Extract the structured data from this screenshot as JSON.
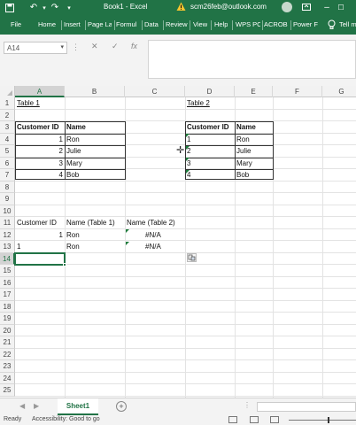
{
  "titlebar": {
    "title": "Book1 - Excel",
    "account": "scm26feb@outlook.com",
    "colors": {
      "brand": "#217346"
    }
  },
  "ribbon_tabs": [
    "File",
    "Home",
    "Insert",
    "Page La",
    "Formul",
    "Data",
    "Review",
    "View",
    "Help",
    "WPS PC",
    "ACROB",
    "Power F"
  ],
  "tell_me": "Tell m",
  "formula_bar": {
    "name_box": "A14",
    "icons": [
      "cancel-icon",
      "enter-icon",
      "fx-icon"
    ],
    "cancel_glyph": "✕",
    "enter_glyph": "✓",
    "fx_glyph": "fx",
    "content": ""
  },
  "columns": [
    "A",
    "B",
    "C",
    "D",
    "E",
    "F",
    "G"
  ],
  "rows": [
    "1",
    "2",
    "3",
    "4",
    "5",
    "6",
    "7",
    "8",
    "9",
    "10",
    "11",
    "12",
    "13",
    "14",
    "15",
    "16",
    "17",
    "18",
    "19",
    "20",
    "21",
    "22",
    "23",
    "24",
    "25"
  ],
  "cells": {
    "A1": "Table 1",
    "D1": "Table 2",
    "A3": "Customer ID",
    "B3": "Name",
    "A4": "1",
    "B4": "Ron",
    "A5": "2",
    "B5": "Julie",
    "A6": "3",
    "B6": "Mary",
    "A7": "4",
    "B7": "Bob",
    "D3": "Customer ID",
    "E3": "Name",
    "D4": "1",
    "E4": "Ron",
    "D5": "2",
    "E5": "Julie",
    "D6": "3",
    "E6": "Mary",
    "D7": "4",
    "E7": "Bob",
    "A11": "Customer ID",
    "B11": "Name (Table 1)",
    "C11": "Name (Table 2)",
    "A12": "1",
    "B12": "Ron",
    "C12": "#N/A",
    "A13": "1",
    "B13": "Ron",
    "C13": "#N/A"
  },
  "active_cell": "A14",
  "sheets": [
    {
      "name": "Sheet1",
      "active": true
    }
  ],
  "add_sheet_glyph": "+",
  "status": {
    "ready": "Ready",
    "accessibility": "Accessibility: Good to go"
  }
}
